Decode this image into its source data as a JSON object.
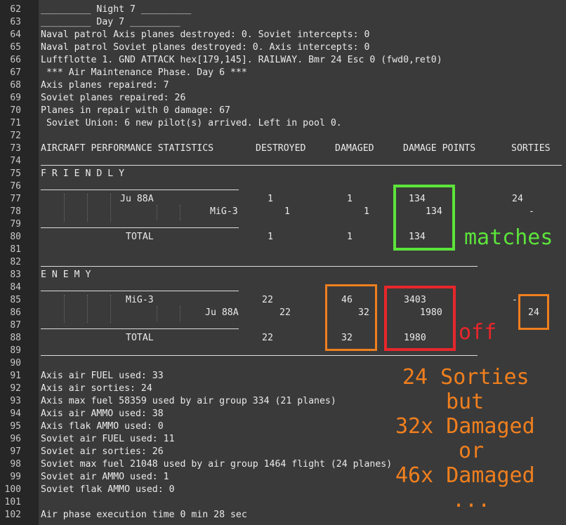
{
  "line_numbers": [
    "62",
    "63",
    "64",
    "65",
    "66",
    "67",
    "68",
    "69",
    "70",
    "71",
    "72",
    "73",
    "74",
    "75",
    "76",
    "77",
    "78",
    "79",
    "80",
    "81",
    "82",
    "83",
    "84",
    "85",
    "86",
    "87",
    "88",
    "89",
    "90",
    "91",
    "92",
    "93",
    "94",
    "95",
    "96",
    "97",
    "98",
    "99",
    "100",
    "101",
    "102"
  ],
  "log": {
    "night7": "_________ Night 7 _________",
    "day7": "_________ Day 7 _________",
    "l64": "Naval patrol Axis planes destroyed: 0. Soviet intercepts: 0",
    "l65": "Naval patrol Soviet planes destroyed: 0. Axis intercepts: 0",
    "l66": "Luftflotte 1. GND ATTACK hex[179,145]. RAILWAY. Bmr 24 Esc 0 (fwd0,ret0)",
    "l67": " *** Air Maintenance Phase. Day 6 ***",
    "l68": "Axis planes repaired: 7",
    "l69": "Soviet planes repaired: 26",
    "l70": "Planes in repair with 0 damage: 67",
    "l71": " Soviet Union: 6 new pilot(s) arrived. Left in pool 0.",
    "l91": "Axis air FUEL used: 33",
    "l92": "Axis air sorties: 24",
    "l93": "Axis max fuel 58359 used by air group 334 (21 planes)",
    "l94": "Axis air AMMO used: 38",
    "l95": "Axis flak AMMO used: 0",
    "l96": "Soviet air FUEL used: 11",
    "l97": "Soviet air sorties: 26",
    "l98": "Soviet max fuel 21048 used by air group 1464 flight (24 planes)",
    "l99": "Soviet air AMMO used: 1",
    "l100": "Soviet flak AMMO used: 0",
    "l102": "Air phase execution time 0 min 28 sec"
  },
  "stats": {
    "title": "AIRCRAFT PERFORMANCE STATISTICS",
    "col_destroyed": "DESTROYED",
    "col_damaged": "DAMAGED",
    "col_damage_points": "DAMAGE POINTS",
    "col_sorties": "SORTIES",
    "friendly_label": "F R I E N D L Y",
    "enemy_label": "E N E M Y",
    "friendly": {
      "row1": {
        "name": "Ju 88A",
        "destroyed": "1",
        "damaged": "1",
        "damage_points": "134",
        "sorties": "24"
      },
      "row2": {
        "name": "MiG-3",
        "destroyed": "1",
        "damaged": "1",
        "damage_points": "134",
        "sorties": "-"
      },
      "total": {
        "name": "TOTAL",
        "destroyed": "1",
        "damaged": "1",
        "damage_points": "134"
      }
    },
    "enemy": {
      "row1": {
        "name": "MiG-3",
        "destroyed": "22",
        "damaged": "46",
        "damage_points": "3403",
        "sorties": "-"
      },
      "row2": {
        "name": "Ju 88A",
        "destroyed": "22",
        "damaged": "32",
        "damage_points": "1980",
        "sorties": "24"
      },
      "total": {
        "name": "TOTAL",
        "destroyed": "22",
        "damaged": "32",
        "damage_points": "1980"
      }
    }
  },
  "annotations": {
    "matches": "matches",
    "off": "off",
    "note1": "24 Sorties",
    "note2": "but",
    "note3": "32x Damaged",
    "note4": "or",
    "note5": "46x Damaged",
    "note6": "..."
  },
  "colors": {
    "green": "#5ce43a",
    "red": "#e8262b",
    "orange": "#f07f1e"
  }
}
